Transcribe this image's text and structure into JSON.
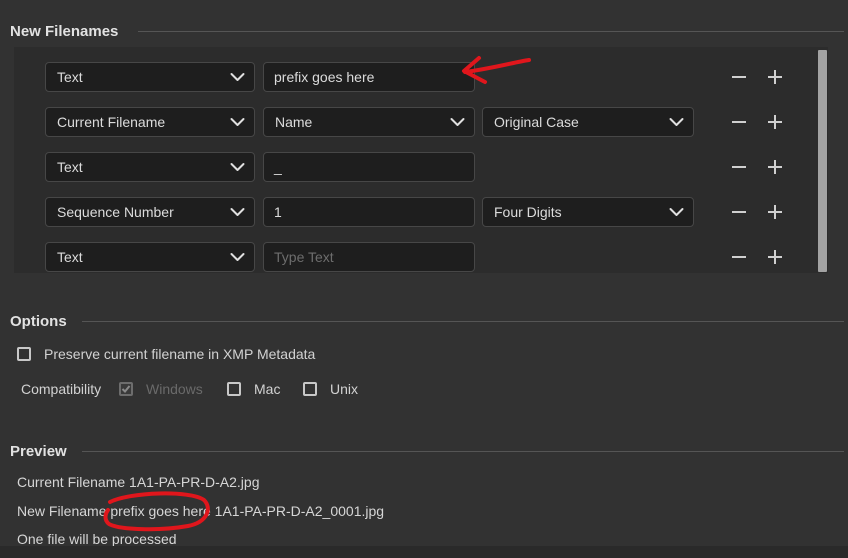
{
  "new_filenames": {
    "title": "New Filenames",
    "rows": [
      {
        "type_label": "Text",
        "field_value": "prefix goes here",
        "field_placeholder": ""
      },
      {
        "type_label": "Current Filename",
        "name_select": "Name",
        "case_select": "Original Case"
      },
      {
        "type_label": "Text",
        "field_value": "_",
        "field_placeholder": ""
      },
      {
        "type_label": "Sequence Number",
        "field_value": "1",
        "digits_select": "Four Digits"
      },
      {
        "type_label": "Text",
        "field_value": "",
        "field_placeholder": "Type Text"
      }
    ]
  },
  "options": {
    "title": "Options",
    "preserve_label": "Preserve current filename in XMP Metadata",
    "preserve_checked": false,
    "compatibility_label": "Compatibility",
    "windows_label": "Windows",
    "windows_checked": true,
    "mac_label": "Mac",
    "mac_checked": false,
    "unix_label": "Unix",
    "unix_checked": false
  },
  "preview": {
    "title": "Preview",
    "current_filename": "Current Filename 1A1-PA-PR-D-A2.jpg",
    "new_filename_prefix": "New Filename",
    "new_filename_highlight": "prefix goes here",
    "new_filename_rest": "1A1-PA-PR-D-A2_0001.jpg",
    "file_count": "One file will be processed"
  },
  "colors": {
    "background": "#323232",
    "field_background": "#1e1e1e",
    "annotation_red": "#e0161c"
  }
}
